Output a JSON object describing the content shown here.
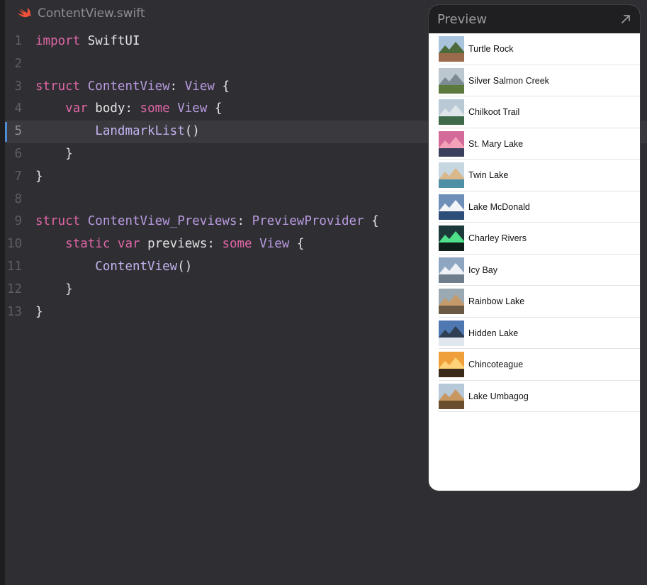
{
  "editor": {
    "file_name": "ContentView.swift",
    "lines": [
      {
        "n": "1",
        "parts": [
          {
            "t": "import",
            "c": "kw"
          },
          {
            "t": " SwiftUI",
            "c": "pl"
          }
        ]
      },
      {
        "n": "2",
        "parts": []
      },
      {
        "n": "3",
        "parts": [
          {
            "t": "struct",
            "c": "kw"
          },
          {
            "t": " ",
            "c": "pl"
          },
          {
            "t": "ContentView",
            "c": "ty"
          },
          {
            "t": ": ",
            "c": "pl"
          },
          {
            "t": "View",
            "c": "ty"
          },
          {
            "t": " {",
            "c": "pl"
          }
        ]
      },
      {
        "n": "4",
        "parts": [
          {
            "t": "    ",
            "c": "pl"
          },
          {
            "t": "var",
            "c": "kw"
          },
          {
            "t": " body: ",
            "c": "pl"
          },
          {
            "t": "some",
            "c": "kw"
          },
          {
            "t": " ",
            "c": "pl"
          },
          {
            "t": "View",
            "c": "ty"
          },
          {
            "t": " {",
            "c": "pl"
          }
        ]
      },
      {
        "n": "5",
        "active": true,
        "parts": [
          {
            "t": "        ",
            "c": "pl"
          },
          {
            "t": "LandmarkList",
            "c": "fn"
          },
          {
            "t": "()",
            "c": "pl"
          }
        ]
      },
      {
        "n": "6",
        "parts": [
          {
            "t": "    }",
            "c": "pl"
          }
        ]
      },
      {
        "n": "7",
        "parts": [
          {
            "t": "}",
            "c": "pl"
          }
        ]
      },
      {
        "n": "8",
        "parts": []
      },
      {
        "n": "9",
        "parts": [
          {
            "t": "struct",
            "c": "kw"
          },
          {
            "t": " ",
            "c": "pl"
          },
          {
            "t": "ContentView_Previews",
            "c": "ty"
          },
          {
            "t": ": ",
            "c": "pl"
          },
          {
            "t": "PreviewProvider",
            "c": "ty"
          },
          {
            "t": " {",
            "c": "pl"
          }
        ]
      },
      {
        "n": "10",
        "parts": [
          {
            "t": "    ",
            "c": "pl"
          },
          {
            "t": "static",
            "c": "kw"
          },
          {
            "t": " ",
            "c": "pl"
          },
          {
            "t": "var",
            "c": "kw"
          },
          {
            "t": " previews: ",
            "c": "pl"
          },
          {
            "t": "some",
            "c": "kw"
          },
          {
            "t": " ",
            "c": "pl"
          },
          {
            "t": "View",
            "c": "ty"
          },
          {
            "t": " {",
            "c": "pl"
          }
        ]
      },
      {
        "n": "11",
        "parts": [
          {
            "t": "        ",
            "c": "pl"
          },
          {
            "t": "ContentView",
            "c": "fn"
          },
          {
            "t": "()",
            "c": "pl"
          }
        ]
      },
      {
        "n": "12",
        "parts": [
          {
            "t": "    }",
            "c": "pl"
          }
        ]
      },
      {
        "n": "13",
        "parts": [
          {
            "t": "}",
            "c": "pl"
          }
        ]
      }
    ]
  },
  "preview": {
    "title": "Preview",
    "expand_icon": "arrow-up-right-icon",
    "landmarks": [
      {
        "name": "Turtle Rock",
        "sky": "#a9c3dc",
        "ground": "#9a6b4a",
        "accent": "#4d6b3a"
      },
      {
        "name": "Silver Salmon Creek",
        "sky": "#bcc7cf",
        "ground": "#5c7a3e",
        "accent": "#7c8a92"
      },
      {
        "name": "Chilkoot Trail",
        "sky": "#b9cad6",
        "ground": "#3f6a4a",
        "accent": "#dfe6ea"
      },
      {
        "name": "St. Mary Lake",
        "sky": "#d46a9a",
        "ground": "#3b3f5e",
        "accent": "#f3a1b8"
      },
      {
        "name": "Twin Lake",
        "sky": "#c7d7e2",
        "ground": "#4e8fa6",
        "accent": "#d9b98c"
      },
      {
        "name": "Lake McDonald",
        "sky": "#6d8fb8",
        "ground": "#2e4e7a",
        "accent": "#f2f4f7"
      },
      {
        "name": "Charley Rivers",
        "sky": "#1d3a3a",
        "ground": "#0f1f1a",
        "accent": "#4fe08a"
      },
      {
        "name": "Icy Bay",
        "sky": "#8fa6c2",
        "ground": "#6e7e8c",
        "accent": "#eef2f6"
      },
      {
        "name": "Rainbow Lake",
        "sky": "#9aa9b2",
        "ground": "#6b5a46",
        "accent": "#c49a6a"
      },
      {
        "name": "Hidden Lake",
        "sky": "#4f78b3",
        "ground": "#dfe6ee",
        "accent": "#2f3e52"
      },
      {
        "name": "Chincoteague",
        "sky": "#f0a03a",
        "ground": "#3a2a18",
        "accent": "#ffd27a"
      },
      {
        "name": "Lake Umbagog",
        "sky": "#b7c9d9",
        "ground": "#6a4e2e",
        "accent": "#c89660"
      }
    ]
  }
}
